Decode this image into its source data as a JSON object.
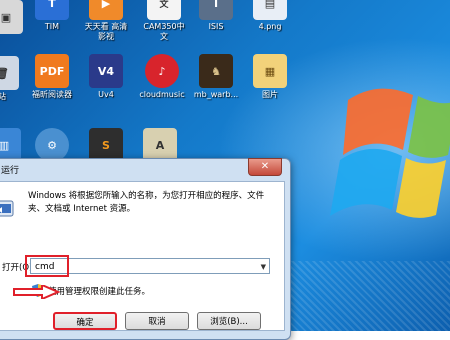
{
  "desktop": {
    "icons_row1": [
      {
        "label": "",
        "name": "desktop-icon-top-0"
      },
      {
        "label": "TIM",
        "name": "desktop-icon-tim"
      },
      {
        "label": "天天看 高清\n影视",
        "name": "desktop-icon-tiantian"
      },
      {
        "label": "CAM350中\n文",
        "name": "desktop-icon-cam350"
      },
      {
        "label": "ISIS",
        "name": "desktop-icon-isis"
      },
      {
        "label": "4.png",
        "name": "desktop-icon-4png"
      }
    ],
    "icons_row2": [
      {
        "label": "站",
        "name": "desktop-icon-station"
      },
      {
        "label": "福昕阅读器",
        "name": "desktop-icon-foxit"
      },
      {
        "label": "Uv4",
        "name": "desktop-icon-uv4"
      },
      {
        "label": "cloudmusic",
        "name": "desktop-icon-cloudmusic"
      },
      {
        "label": "mb_warb...",
        "name": "desktop-icon-mbwarb"
      },
      {
        "label": "图片",
        "name": "desktop-icon-pictures"
      }
    ]
  },
  "run_dialog": {
    "title": "运行",
    "close_label": "✕",
    "description": "Windows 将根据您所输入的名称，为您打开相应的程序、文件夹、文档或 Internet 资源。",
    "open_label": "打开(O):",
    "input_value": "cmd",
    "admin_note": "使用管理权限创建此任务。",
    "buttons": {
      "ok": "确定",
      "cancel": "取消",
      "browse": "浏览(B)..."
    }
  },
  "colors": {
    "highlight": "#e0202a",
    "desktop_blue": "#1479c9"
  }
}
